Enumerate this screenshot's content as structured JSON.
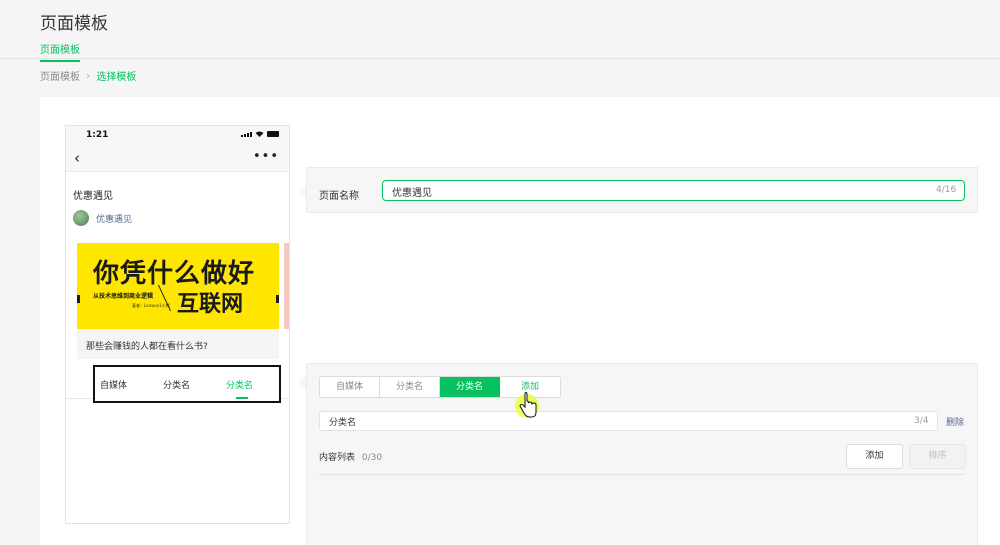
{
  "header": {
    "title": "页面模板",
    "tab": "页面模板"
  },
  "breadcrumb": {
    "root": "页面模板",
    "current": "选择模板"
  },
  "phone": {
    "time": "1:21",
    "article_title": "优惠遇见",
    "account_name": "优惠遇见",
    "cover": {
      "line1": "你凭什么做好",
      "line2": "从技术思维到商业逻辑",
      "line3": "著者：Lonwoo1小熊",
      "line4": "互联网"
    },
    "description": "那些会赚钱的人都在看什么书?",
    "tabs": [
      "自媒体",
      "分类名",
      "分类名"
    ]
  },
  "form_page": {
    "label": "页面名称",
    "value": "优惠遇见",
    "count": "4/16"
  },
  "form_category": {
    "segments": [
      "自媒体",
      "分类名",
      "分类名",
      "添加"
    ],
    "active_index": 2,
    "name_value": "分类名",
    "name_count": "3/4",
    "delete_label": "删除",
    "list_label": "内容列表",
    "list_count": "0/30",
    "add_label": "添加",
    "sort_label": "排序"
  },
  "colors": {
    "accent": "#07c160",
    "link": "#576b95"
  }
}
